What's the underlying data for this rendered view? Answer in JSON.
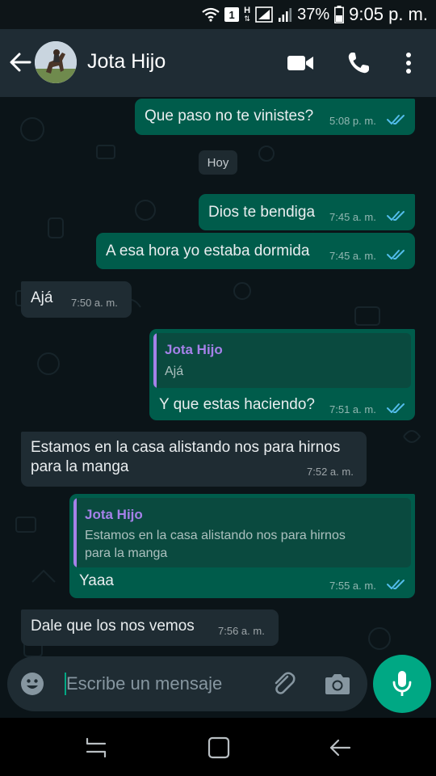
{
  "status_bar": {
    "sim_label": "1",
    "network_label": "H",
    "battery": "37%",
    "time": "9:05 p. m."
  },
  "header": {
    "contact_name": "Jota Hijo",
    "icons": [
      "back-arrow-icon",
      "avatar",
      "video-call-icon",
      "phone-icon",
      "more-vert-icon"
    ]
  },
  "messages": [
    {
      "direction": "out",
      "text": "Que paso no te vinistes?",
      "time": "5:08 p. m.",
      "status": "read"
    },
    {
      "type": "date",
      "text": "Hoy"
    },
    {
      "direction": "out",
      "text": "Dios te bendiga",
      "time": "7:45 a. m.",
      "status": "read"
    },
    {
      "direction": "out",
      "text": "A esa hora yo estaba dormida",
      "time": "7:45 a. m.",
      "status": "read"
    },
    {
      "direction": "in",
      "text": "Ajá",
      "time": "7:50 a. m."
    },
    {
      "direction": "out",
      "quote": {
        "name": "Jota Hijo",
        "text": "Ajá"
      },
      "text": "Y que estas haciendo?",
      "time": "7:51 a. m.",
      "status": "read"
    },
    {
      "direction": "in",
      "text_lines": [
        "Estamos en la casa alistando nos para hirnos",
        "para la manga"
      ],
      "time": "7:52 a. m."
    },
    {
      "direction": "out",
      "quote": {
        "name": "Jota Hijo",
        "text_lines": [
          "Estamos en la casa alistando nos para hirnos",
          "para la manga"
        ]
      },
      "text": "Yaaa",
      "time": "7:55 a. m.",
      "status": "read"
    },
    {
      "direction": "in",
      "text": "Dale que los nos vemos",
      "time": "7:56 a. m."
    }
  ],
  "composer": {
    "placeholder": "Escribe un mensaje",
    "value": ""
  },
  "colors": {
    "header_bg": "#1f2c34",
    "chat_bg": "#0b1418",
    "outgoing_bubble": "#005c4b",
    "incoming_bubble": "#1f2c33",
    "accent": "#00a884",
    "read_ticks": "#53bdeb",
    "quote_name": "#a581e9"
  }
}
